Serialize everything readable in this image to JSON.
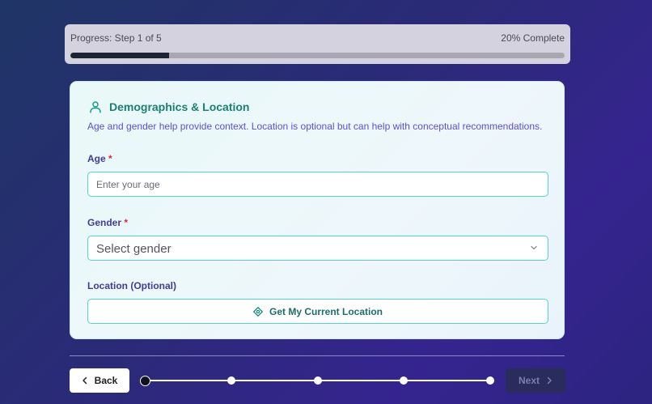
{
  "progress": {
    "step_text": "Progress: Step 1 of 5",
    "percent_text": "20% Complete",
    "fraction": 0.2
  },
  "section": {
    "icon": "user-icon",
    "title": "Demographics & Location",
    "description": "Age and gender help provide context. Location is optional but can help with conceptual recommendations."
  },
  "fields": {
    "age": {
      "label": "Age",
      "required_mark": "*",
      "value": "",
      "placeholder": "Enter your age"
    },
    "gender": {
      "label": "Gender",
      "required_mark": "*",
      "selected": "Select gender"
    },
    "location": {
      "label": "Location (Optional)",
      "button_label": "Get My Current Location",
      "icon": "location-crosshair-icon"
    }
  },
  "nav": {
    "back_label": "Back",
    "next_label": "Next",
    "total_steps": 5,
    "current_step": 1
  },
  "colors": {
    "accent_teal": "#1b7f74",
    "input_border": "#52d6c6",
    "label_indigo": "#3e3e9a",
    "description_violet": "#5b50d6",
    "required_red": "#e0283f"
  }
}
